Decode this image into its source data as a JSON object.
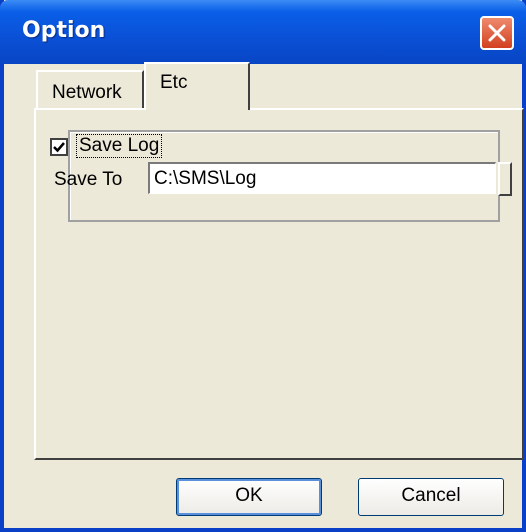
{
  "window": {
    "title": "Option"
  },
  "tabs": [
    {
      "label": "Network",
      "active": false
    },
    {
      "label": "Etc",
      "active": true
    }
  ],
  "etc_panel": {
    "save_log_label": "Save Log",
    "save_log_checked": true,
    "save_to_label": "Save To",
    "save_to_value": "C:\\SMS\\Log"
  },
  "buttons": {
    "ok_label": "OK",
    "cancel_label": "Cancel"
  },
  "colors": {
    "titlebar": "#0a50d6",
    "close_button": "#d2401e",
    "dialog_background": "#ece9d8"
  },
  "icons": {
    "close": "close-icon",
    "check": "check-icon"
  }
}
